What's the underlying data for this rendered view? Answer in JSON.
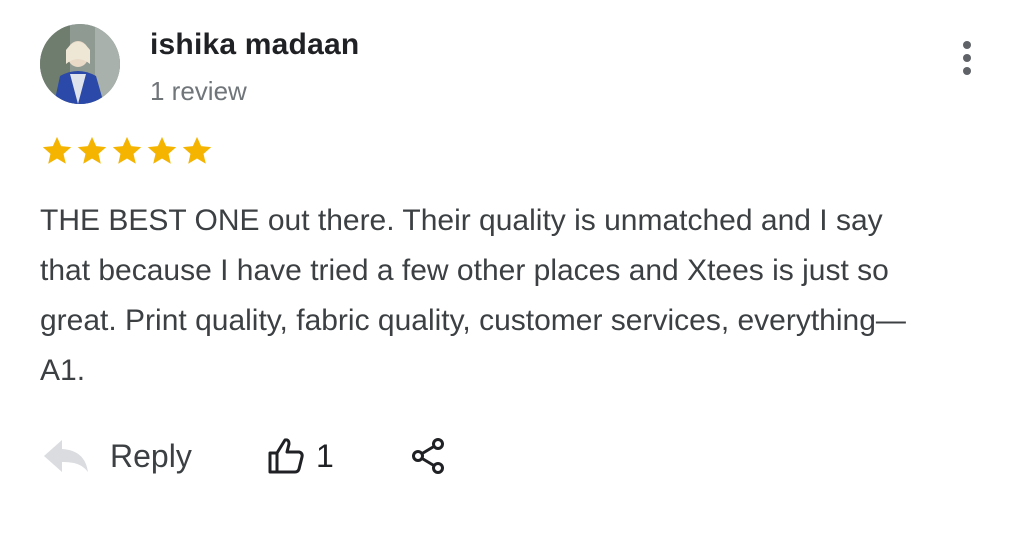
{
  "review": {
    "author_name": "ishika madaan",
    "author_review_count": "1 review",
    "rating": 5,
    "rating_max": 5,
    "star_color": "#F4B400",
    "text": "THE BEST ONE out there. Their quality is unmatched and I say that because I have tried a few other places and Xtees is just so great. Print quality, fabric quality, customer services, everything— A1."
  },
  "actions": {
    "reply_label": "Reply",
    "like_count": "1"
  },
  "icons": {
    "more": "more-vert-icon",
    "reply": "reply-arrow-icon",
    "like": "thumbs-up-icon",
    "share": "share-icon",
    "star": "star-icon"
  }
}
